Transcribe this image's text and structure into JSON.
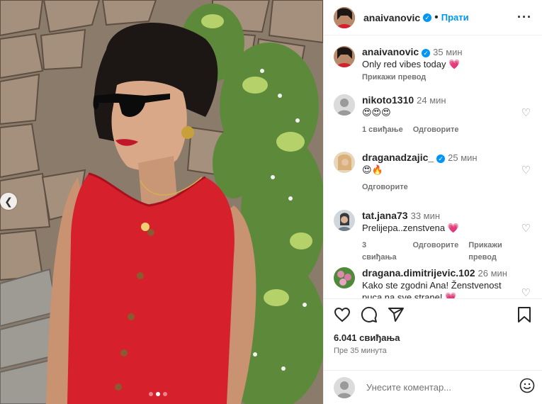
{
  "post": {
    "author": "anaivanovic",
    "follow_label": "Прати",
    "more_icon": "more-horizontal-icon",
    "carousel": {
      "total": 3,
      "active": 2
    }
  },
  "caption": {
    "username": "anaivanovic",
    "time": "35 мин",
    "text": "Only red vibes today 💗",
    "translate_label": "Прикажи превод"
  },
  "comments": [
    {
      "username": "nikoto1310",
      "time": "24 мин",
      "text": "😍😍😍",
      "likes": "1 свиђање",
      "reply": "Одговорите",
      "translate": ""
    },
    {
      "username": "draganadzajic_",
      "verified": true,
      "time": "25 мин",
      "text": "😍🔥",
      "likes": "",
      "reply": "Одговорите",
      "translate": ""
    },
    {
      "username": "tat.jana73",
      "time": "33 мин",
      "text": "Prelijepa..zenstvena 💗",
      "likes": "3 свиђања",
      "reply": "Одговорите",
      "translate": "Прикажи превод"
    },
    {
      "username": "dragana.dimitrijevic.102",
      "time": "26 мин",
      "text": "Kako ste zgodni Ana! Ženstvenost pucа na sve strane! 💗",
      "likes": "",
      "reply": "",
      "translate": ""
    }
  ],
  "stats": {
    "likes": "6.041 свиђања",
    "posted": "Пре 35 минута"
  },
  "add_comment": {
    "placeholder": "Унесите коментар..."
  },
  "colors": {
    "accent": "#0095f6",
    "dress": "#d6202c",
    "text": "#262626",
    "muted": "#737373"
  }
}
